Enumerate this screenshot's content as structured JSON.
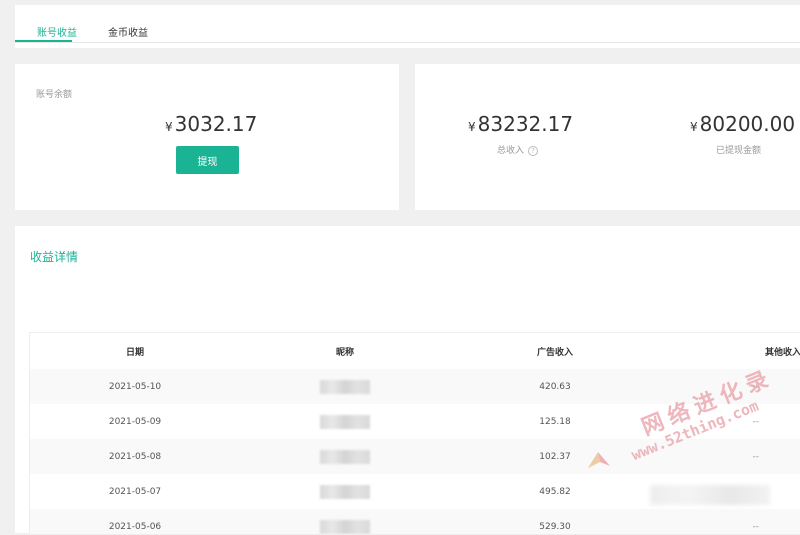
{
  "tabs": [
    {
      "label": "账号收益",
      "active": true
    },
    {
      "label": "金币收益",
      "active": false
    }
  ],
  "balance": {
    "label": "账号余额",
    "currency": "¥",
    "amount": "3032.17",
    "withdraw_button": "提现"
  },
  "summary": {
    "total_income": {
      "currency": "¥",
      "amount": "83232.17",
      "label": "总收入",
      "help_icon": "question-circle-icon"
    },
    "withdrawn": {
      "currency": "¥",
      "amount": "80200.00",
      "label": "已提现金额"
    }
  },
  "detail": {
    "title": "收益详情",
    "columns": [
      "日期",
      "昵称",
      "广告收入",
      "其他收入"
    ],
    "rows": [
      {
        "date": "2021-05-10",
        "ad": "420.63",
        "other": "--"
      },
      {
        "date": "2021-05-09",
        "ad": "125.18",
        "other": "--"
      },
      {
        "date": "2021-05-08",
        "ad": "102.37",
        "other": "--"
      },
      {
        "date": "2021-05-07",
        "ad": "495.82",
        "other": "--"
      },
      {
        "date": "2021-05-06",
        "ad": "529.30",
        "other": "--"
      }
    ]
  },
  "watermark": {
    "line1": "网络进化录",
    "line2": "www.52thing.com"
  },
  "colors": {
    "accent": "#1ab394",
    "watermark": "#e8a0a8"
  }
}
